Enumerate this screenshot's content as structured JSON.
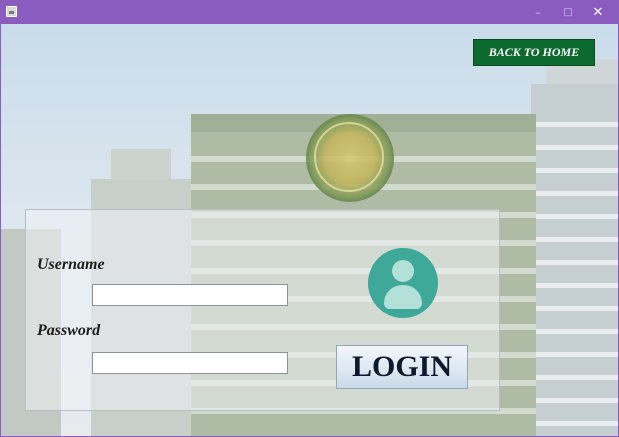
{
  "window": {
    "title": "",
    "controls": {
      "minimize": "–",
      "maximize": "□",
      "close": "✕"
    }
  },
  "header": {
    "back_label": "BACK TO HOME"
  },
  "form": {
    "username_label": "Username",
    "username_value": "",
    "password_label": "Password",
    "password_value": "",
    "login_label": "LOGIN"
  },
  "icons": {
    "app": "java-app-icon",
    "avatar": "user-avatar-icon",
    "seal": "city-seal-emblem"
  },
  "colors": {
    "titlebar": "#8a5cc0",
    "back_button": "#0c6a2e",
    "avatar": "#3fa999"
  }
}
